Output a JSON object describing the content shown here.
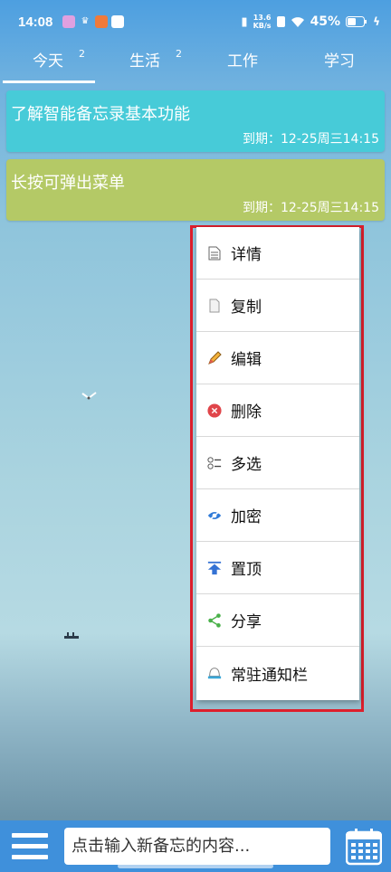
{
  "status_bar": {
    "time": "14:08",
    "network_speed_value": "13.6",
    "network_speed_unit": "KB/s",
    "battery": "45%"
  },
  "tabs": [
    {
      "label": "今天",
      "badge": "2",
      "active": true
    },
    {
      "label": "生活",
      "badge": "2",
      "active": false
    },
    {
      "label": "工作",
      "badge": "",
      "active": false
    },
    {
      "label": "学习",
      "badge": "",
      "active": false
    }
  ],
  "memos": [
    {
      "title": "了解智能备忘录基本功能",
      "due": "到期：12-25周三14:15",
      "color": "#47cbd8"
    },
    {
      "title": "长按可弹出菜单",
      "due": "到期：12-25周三14:15",
      "color": "#b4c966"
    }
  ],
  "context_menu": {
    "items": [
      {
        "label": "详情",
        "icon": "document-icon"
      },
      {
        "label": "复制",
        "icon": "copy-icon"
      },
      {
        "label": "编辑",
        "icon": "pencil-icon"
      },
      {
        "label": "删除",
        "icon": "delete-icon"
      },
      {
        "label": "多选",
        "icon": "multi-select-icon"
      },
      {
        "label": "加密",
        "icon": "encrypt-eye-icon"
      },
      {
        "label": "置顶",
        "icon": "pin-top-icon"
      },
      {
        "label": "分享",
        "icon": "share-icon"
      },
      {
        "label": "常驻通知栏",
        "icon": "notification-bell-icon"
      }
    ],
    "highlight_color": "#dd1f2c"
  },
  "bottom_bar": {
    "input_placeholder": "点击输入新备忘的内容...",
    "accent": "#3f90db"
  }
}
